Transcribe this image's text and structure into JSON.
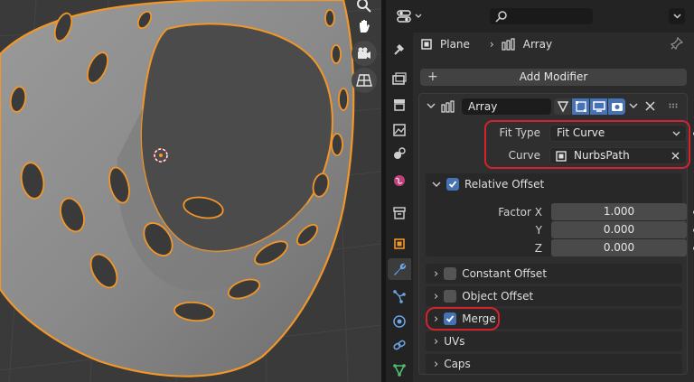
{
  "breadcrumb": {
    "object": "Plane",
    "modifier": "Array"
  },
  "add_modifier_label": "Add Modifier",
  "modifier": {
    "name": "Array",
    "fit_type": {
      "label": "Fit Type",
      "value": "Fit Curve"
    },
    "curve": {
      "label": "Curve",
      "value": "NurbsPath"
    },
    "relative_offset": {
      "label": "Relative Offset",
      "checked": true,
      "factors": [
        {
          "label": "Factor X",
          "value": "1.000"
        },
        {
          "label": "Y",
          "value": "0.000"
        },
        {
          "label": "Z",
          "value": "0.000"
        }
      ]
    },
    "constant_offset": {
      "label": "Constant Offset",
      "checked": false
    },
    "object_offset": {
      "label": "Object Offset",
      "checked": false
    },
    "merge": {
      "label": "Merge",
      "checked": true
    },
    "uvs_label": "UVs",
    "caps_label": "Caps"
  },
  "colors": {
    "accent_blue": "#4772b3",
    "highlight_red": "#d5232e",
    "selection_orange": "#f0962a",
    "wrench_blue": "#6aa6e6"
  },
  "icons": {
    "viewport": [
      "zoom-icon",
      "hand-pan-icon",
      "camera-icon",
      "grid-icon"
    ],
    "tabs": [
      "tool-icon",
      "render-icon",
      "output-icon",
      "view-layer-icon",
      "scene-icon",
      "world-icon",
      "collection-icon",
      "object-icon",
      "modifier-wrench-icon",
      "particles-icon",
      "physics-icon",
      "constraints-icon",
      "data-icon"
    ]
  }
}
